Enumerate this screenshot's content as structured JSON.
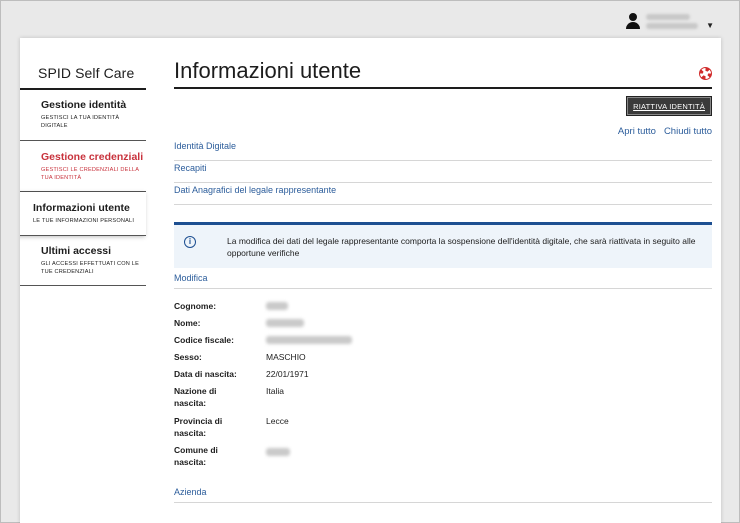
{
  "user": {
    "icon": "user-icon"
  },
  "sidebar": {
    "brand": "SPID Self Care",
    "items": [
      {
        "title": "Gestione identità",
        "subtitle": "GESTISCI LA TUA IDENTITÀ DIGITALE"
      },
      {
        "title": "Gestione credenziali",
        "subtitle": "GESTISCI LE CREDENZIALI DELLA TUA IDENTITÀ",
        "color": "#c8323c"
      },
      {
        "title": "Informazioni utente",
        "subtitle": "LE TUE INFORMAZIONI PERSONALI",
        "active": true
      },
      {
        "title": "Ultimi accessi",
        "subtitle": "GLI ACCESSI EFFETTUATI CON LE TUE CREDENZIALI"
      }
    ]
  },
  "main": {
    "title": "Informazioni utente",
    "reactivate_label": "RIATTIVA IDENTITÀ",
    "expand_all": "Apri tutto",
    "collapse_all": "Chiudi tutto",
    "sections": [
      "Identità Digitale",
      "Recapiti",
      "Dati Anagrafici del legale rappresentante"
    ],
    "notice": "La modifica dei dati del legale rappresentante comporta la sospensione dell'identità digitale, che sarà riattivata in seguito alle opportune verifiche",
    "edit_link": "Modifica",
    "fields": [
      {
        "label": "Cognome:",
        "value": ""
      },
      {
        "label": "Nome:",
        "value": ""
      },
      {
        "label": "Codice fiscale:",
        "value": ""
      },
      {
        "label": "Sesso:",
        "value": "MASCHIO"
      },
      {
        "label": "Data di nascita:",
        "value": "22/01/1971"
      },
      {
        "label": "Nazione di nascita:",
        "value": "Italia"
      },
      {
        "label": "Provincia di nascita:",
        "value": "Lecce"
      },
      {
        "label": "Comune di nascita:",
        "value": ""
      }
    ],
    "company_link": "Azienda"
  },
  "colors": {
    "accent": "#2c5d9b",
    "danger": "#c8323c",
    "notice_border": "#1d4f91"
  }
}
